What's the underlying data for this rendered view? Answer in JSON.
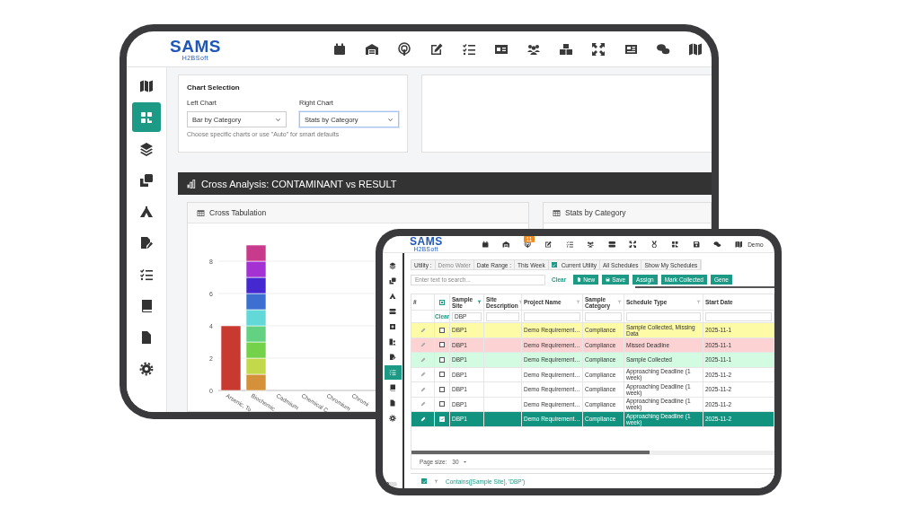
{
  "big_tablet": {
    "logo": {
      "text": "SAMS",
      "subtext": "H2BSoft"
    },
    "sidebar": [
      {
        "selected": false
      },
      {
        "selected": true
      },
      {
        "selected": false
      },
      {
        "selected": false
      },
      {
        "selected": false
      },
      {
        "selected": false
      },
      {
        "selected": false
      },
      {
        "selected": false
      },
      {
        "selected": false
      },
      {
        "selected": false
      }
    ],
    "chart_selection": {
      "title": "Chart Selection",
      "fields": [
        {
          "label": "Left Chart",
          "value": "Bar by Category",
          "focused": false
        },
        {
          "label": "Right Chart",
          "value": "Stats by Category",
          "focused": true
        }
      ],
      "hint": "Choose specific charts or use \"Auto\" for smart defaults"
    },
    "banner": {
      "title": "Cross Analysis: CONTAMINANT vs RESULT"
    },
    "panels": [
      {
        "title": "Cross Tabulation",
        "chart_data": {
          "type": "bar",
          "stacked": true,
          "categories": [
            "Arsenic, To",
            "Biochemic",
            "Cadmium",
            "Chemical C",
            "Chromium",
            "Chromi"
          ],
          "grid": true,
          "ylim": [
            0,
            9
          ],
          "yticks": [
            0,
            2,
            4,
            6,
            8
          ],
          "series": [
            {
              "color": "#c8392f",
              "values": [
                4,
                null,
                null,
                null,
                null,
                null
              ]
            },
            {
              "color": "#d4913a",
              "values": [
                null,
                1,
                null,
                null,
                null,
                null
              ]
            },
            {
              "color": "#c3d94b",
              "values": [
                null,
                1,
                null,
                null,
                null,
                null
              ]
            },
            {
              "color": "#74d24a",
              "values": [
                null,
                1,
                null,
                null,
                null,
                null
              ]
            },
            {
              "color": "#62d282",
              "values": [
                null,
                1,
                null,
                null,
                null,
                null
              ]
            },
            {
              "color": "#62d8d8",
              "values": [
                null,
                1,
                null,
                null,
                null,
                null
              ]
            },
            {
              "color": "#3c6fd0",
              "values": [
                null,
                1,
                null,
                null,
                null,
                null
              ]
            },
            {
              "color": "#4528d0",
              "values": [
                null,
                1,
                null,
                null,
                null,
                null
              ]
            },
            {
              "color": "#a431d2",
              "values": [
                null,
                1,
                null,
                null,
                null,
                null
              ]
            },
            {
              "color": "#c83a8c",
              "values": [
                null,
                1,
                null,
                null,
                null,
                null
              ]
            }
          ]
        }
      },
      {
        "title": "Stats by Category"
      }
    ]
  },
  "small_tablet": {
    "logo": {
      "text": "SAMS",
      "subtext": "H2BSoft"
    },
    "notification_badge": "11",
    "user": "Demo",
    "sidebar": [
      {
        "selected": false
      },
      {
        "selected": false
      },
      {
        "selected": false
      },
      {
        "selected": false
      },
      {
        "selected": false
      },
      {
        "selected": false
      },
      {
        "selected": false
      },
      {
        "selected": true
      },
      {
        "selected": false
      },
      {
        "selected": false
      },
      {
        "selected": false
      }
    ],
    "toggle": {
      "on": false
    },
    "filter_bar": [
      {
        "kind": "label",
        "text": "Utility :"
      },
      {
        "kind": "muted",
        "text": "Demo Water"
      },
      {
        "kind": "label",
        "text": "Date Range :"
      },
      {
        "kind": "option",
        "text": "This Week"
      },
      {
        "kind": "checkbox",
        "text": "Current Utility",
        "checked": true
      },
      {
        "kind": "option",
        "text": "All Schedules"
      },
      {
        "kind": "option",
        "text": "Show My Schedules"
      }
    ],
    "search": {
      "placeholder": "Enter text to search...",
      "clear": "Clear"
    },
    "buttons": [
      {
        "kind": "new",
        "label": "New"
      },
      {
        "kind": "save",
        "label": "Save"
      },
      {
        "kind": "plain",
        "label": "Assign"
      },
      {
        "kind": "plain",
        "label": "Mark Collected"
      },
      {
        "kind": "plain",
        "label": "Gene"
      }
    ],
    "table": {
      "header_checkbox": {
        "indeterminate": true
      },
      "columns": [
        {
          "label": "Sample Site",
          "filtered": true
        },
        {
          "label": "Site Description",
          "filtered": false
        },
        {
          "label": "Project Name",
          "filtered": false
        },
        {
          "label": "Sample Category",
          "filtered": false
        },
        {
          "label": "Schedule Type",
          "filtered": false
        },
        {
          "label": "Start Date"
        }
      ],
      "first_column": "#",
      "clear": "Clear",
      "site_filter": "DBP",
      "rows": [
        {
          "color": "#fdfba6",
          "checked": false,
          "selected": false,
          "site": "DBP1",
          "project": "Demo Requirement…",
          "category": "Compliance",
          "schedule": "Sample Collected, Missing Data",
          "start": "2025-11-1"
        },
        {
          "color": "#fdd2d2",
          "checked": false,
          "selected": false,
          "site": "DBP1",
          "project": "Demo Requirement…",
          "category": "Compliance",
          "schedule": "Missed Deadline",
          "start": "2025-11-1"
        },
        {
          "color": "#d2fbe2",
          "checked": false,
          "selected": false,
          "site": "DBP1",
          "project": "Demo Requirement…",
          "category": "Compliance",
          "schedule": "Sample Collected",
          "start": "2025-11-1"
        },
        {
          "color": "#ffffff",
          "checked": false,
          "selected": false,
          "site": "DBP1",
          "project": "Demo Requirement…",
          "category": "Compliance",
          "schedule": "Approaching Deadline (1 week)",
          "start": "2025-11-2"
        },
        {
          "color": "#ffffff",
          "checked": false,
          "selected": false,
          "site": "DBP1",
          "project": "Demo Requirement…",
          "category": "Compliance",
          "schedule": "Approaching Deadline (1 week)",
          "start": "2025-11-2"
        },
        {
          "color": "#ffffff",
          "checked": false,
          "selected": false,
          "site": "DBP1",
          "project": "Demo Requirement…",
          "category": "Compliance",
          "schedule": "Approaching Deadline (1 week)",
          "start": "2025-11-2"
        },
        {
          "checked": true,
          "selected": true,
          "site": "DBP1",
          "project": "Demo Requirement…",
          "category": "Compliance",
          "schedule": "Approaching Deadline (1 week)",
          "start": "2025-11-2"
        }
      ]
    },
    "page_size": {
      "label": "Page size:",
      "value": "30"
    },
    "active_filter": {
      "checked": true,
      "text": "Contains([Sample Site], 'DBP')"
    }
  }
}
